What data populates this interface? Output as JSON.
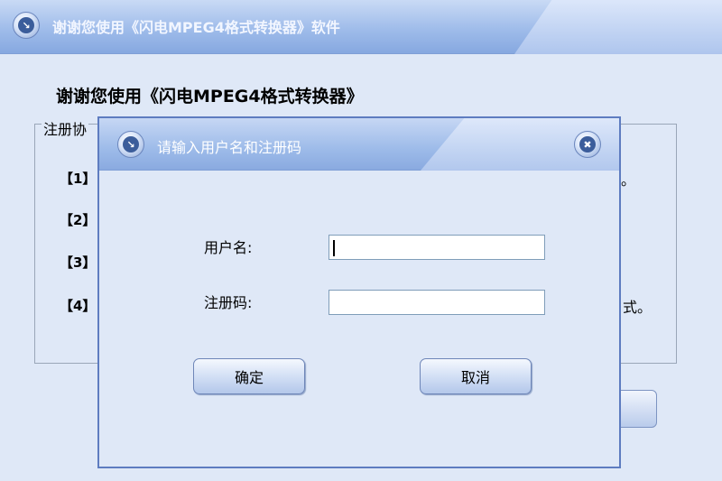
{
  "main_window": {
    "title": "谢谢您使用《闪电MPEG4格式转换器》软件",
    "heading": "谢谢您使用《闪电MPEG4格式转换器》",
    "agreement_legend": "注册协",
    "clauses": [
      {
        "label": "【1】"
      },
      {
        "label": "【2】"
      },
      {
        "label": "【3】"
      },
      {
        "label": "【4】"
      }
    ],
    "clause_tails": [
      "。",
      "式。"
    ]
  },
  "dialog": {
    "title": "请输入用户名和注册码",
    "username_label": "用户名:",
    "username_value": "",
    "regcode_label": "注册码:",
    "regcode_value": "",
    "ok_label": "确定",
    "cancel_label": "取消"
  },
  "icons": {
    "main_title_icon": "arrow-down-right-icon",
    "dialog_title_icon": "arrow-down-right-icon",
    "dialog_close_icon": "close-icon"
  },
  "colors": {
    "background": "#dfe8f7",
    "titlebar": "#9fbcea",
    "dialog_border": "#5e7cc0"
  }
}
